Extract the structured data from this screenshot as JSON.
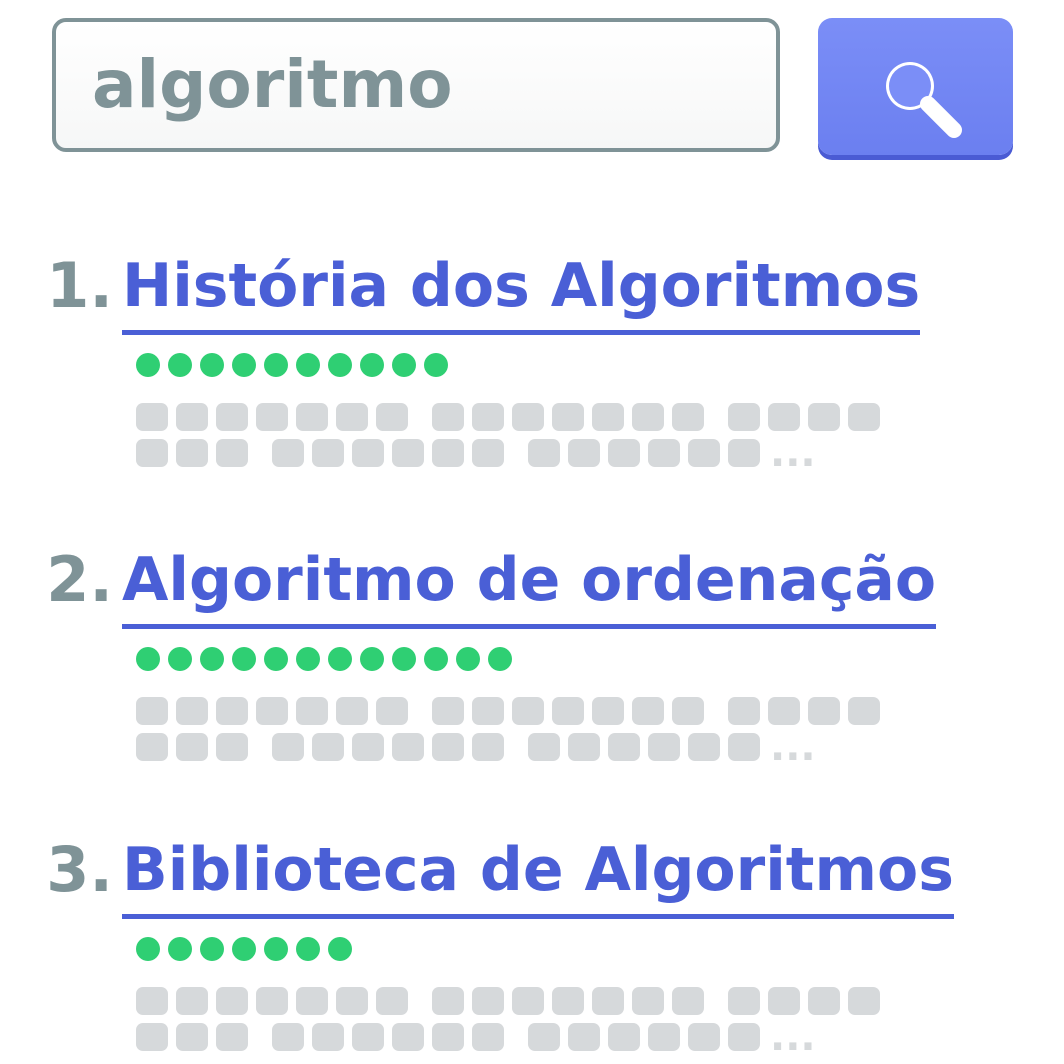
{
  "search": {
    "query": "algoritmo",
    "button_icon": "search-icon",
    "button_color": "#6b7ff0"
  },
  "colors": {
    "title_link": "#4a5fd6",
    "number": "#7f9397",
    "rating_dots": "#2fcf73",
    "snippet_placeholder": "#d6d9db"
  },
  "results": [
    {
      "number": "1.",
      "title": "História dos Algoritmos",
      "rating_dots": 10,
      "snippet_line_1_words": [
        7,
        7,
        4
      ],
      "snippet_line_2_words": [
        3,
        6,
        6
      ],
      "snippet_ellipsis": "..."
    },
    {
      "number": "2.",
      "title": "Algoritmo de ordenação",
      "rating_dots": 12,
      "snippet_line_1_words": [
        7,
        7,
        4
      ],
      "snippet_line_2_words": [
        3,
        6,
        6
      ],
      "snippet_ellipsis": "..."
    },
    {
      "number": "3.",
      "title": "Biblioteca de Algoritmos",
      "rating_dots": 7,
      "snippet_line_1_words": [
        7,
        7,
        4
      ],
      "snippet_line_2_words": [
        3,
        6,
        6
      ],
      "snippet_ellipsis": "..."
    }
  ]
}
